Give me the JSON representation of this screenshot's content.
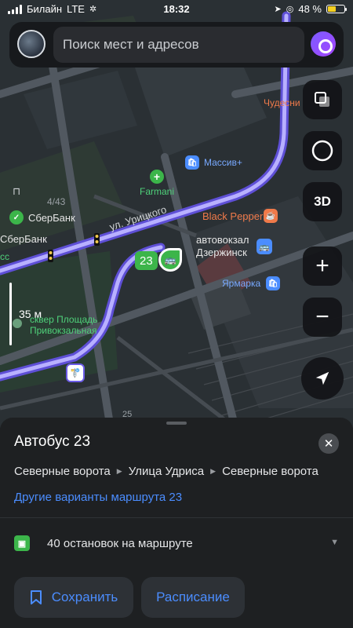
{
  "status_bar": {
    "carrier": "Билайн",
    "network": "LTE",
    "time": "18:32",
    "battery": "48 %",
    "battery_level": 0.48
  },
  "search": {
    "placeholder": "Поиск мест и адресов"
  },
  "map": {
    "labels": {
      "chudesnitsa": "Чудесни",
      "massiv": "Массив+",
      "farmani": "Farmani",
      "house_number": "4/43",
      "sberbank_1": "СберБанк",
      "sberbank_2": "СберБанк",
      "kass": "сс",
      "black_pepper": "Black Pepper",
      "street_uritskogo": "ул. Урицкого",
      "bus_station_line1": "автовокзал",
      "bus_station_line2": "Дзержинск",
      "yarmarka": "Ярмарка",
      "route_badge": "23",
      "scale": "35 м",
      "square_line1": "сквер Площадь",
      "square_line2": "Привокзальная",
      "house_25": "25"
    },
    "buttons": {
      "layers": "layers-icon",
      "threed": "3D",
      "zoom_in": "+",
      "zoom_out": "−"
    }
  },
  "sheet": {
    "title": "Автобус 23",
    "route": [
      "Северные ворота",
      "Улица Удриса",
      "Северные ворота"
    ],
    "other_variants": "Другие варианты маршрута 23",
    "stops": "40 остановок на маршруте",
    "save": "Сохранить",
    "schedule": "Расписание"
  },
  "colors": {
    "route_line": "#8c7bff",
    "accent_blue": "#4b8dff",
    "bus_green": "#3cb54a",
    "poi_orange": "#f07a4a"
  }
}
